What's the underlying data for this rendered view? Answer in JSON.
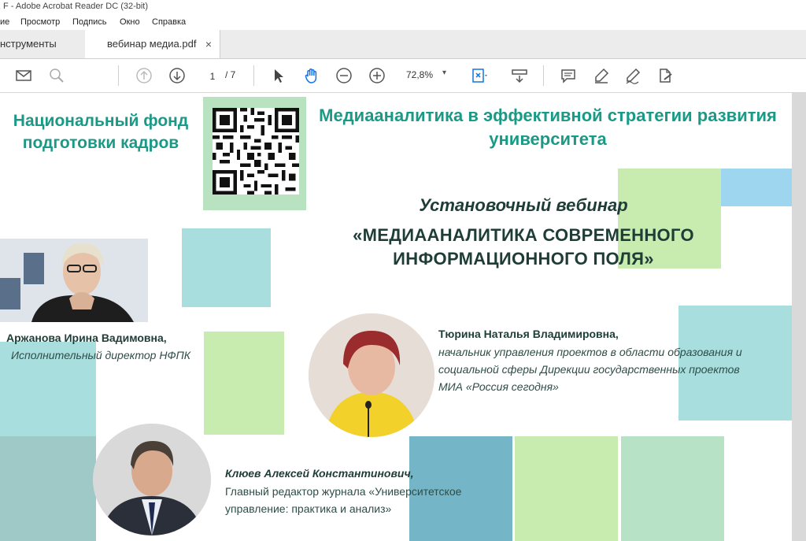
{
  "window": {
    "title": "F - Adobe Acrobat Reader DC (32-bit)"
  },
  "menu": {
    "items": [
      "ие",
      "Просмотр",
      "Подпись",
      "Окно",
      "Справка"
    ]
  },
  "tabs": {
    "tools": "нструменты",
    "document": "вебинар медиа.pdf",
    "close": "×"
  },
  "toolbar": {
    "page_current": "1",
    "page_total": "/ 7",
    "zoom": "72,8%",
    "icons": [
      "mail-icon",
      "search-icon",
      "prev-page-icon",
      "next-page-icon",
      "cursor-icon",
      "hand-icon",
      "zoom-out-icon",
      "zoom-in-icon",
      "fit-page-icon",
      "scroll-mode-icon",
      "comment-icon",
      "highlight-icon",
      "sign-icon",
      "fill-sign-icon"
    ]
  },
  "slide": {
    "org": "Национальный фонд подготовки кадров",
    "title": "Медиааналитика в эффективной стратегии развития университета",
    "webinar_type": "Установочный вебинар",
    "webinar_name": "«МЕДИААНАЛИТИКА СОВРЕМЕННОГО ИНФОРМАЦИОННОГО ПОЛЯ»",
    "speakers": [
      {
        "name": "Аржанова Ирина Вадимовна,",
        "role": "Исполнительный директор НФПК"
      },
      {
        "name": "Тюрина Наталья Владимировна,",
        "role": "начальник управления проектов в области образования и социальной сферы Дирекции государственных проектов МИА «Россия сегодня»"
      },
      {
        "name": "Клюев Алексей Константинович,",
        "role": "Главный редактор журнала «Университетское управление: практика и анализ»"
      }
    ]
  },
  "colors": {
    "accent_green": "#1a9a86",
    "dark_text": "#1f3d37",
    "toolbar_icon": "#555555",
    "active_icon": "#1473e6"
  }
}
